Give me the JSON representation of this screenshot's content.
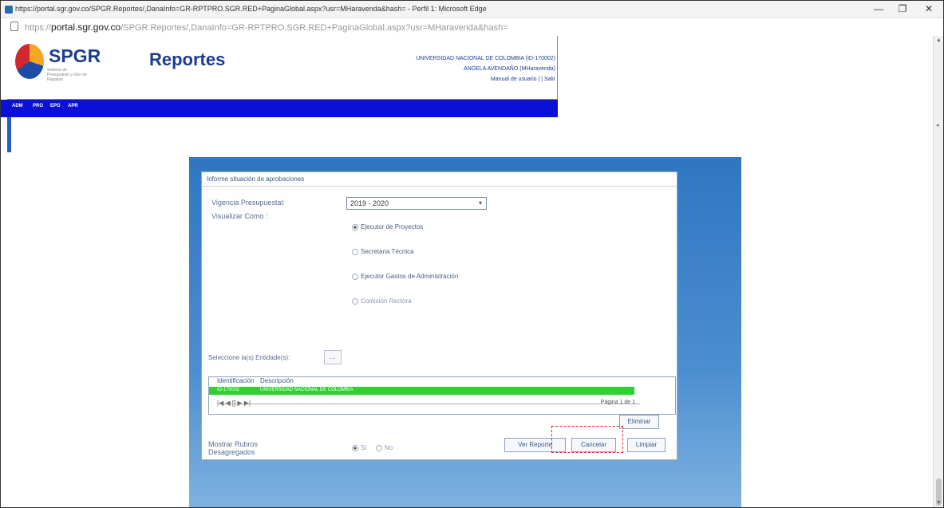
{
  "browser": {
    "window_title": "https://portal.sgr.gov.co/SPGR.Reportes/,DanaInfo=GR-RPTPRO.SGR.RED+PaginaGlobal.aspx?usr=MHaravenda&hash= - Perfil 1: Microsoft Edge",
    "url_prefix": "https://",
    "url_domain": "portal.sgr.gov.co",
    "url_path": "/SPGR.Reportes/,DanaInfo=GR-RPTPRO.SGR.RED+PaginaGlobal.aspx?usr=MHaravenda&hash=",
    "minimize": "—",
    "maximize": "❐",
    "close": "✕"
  },
  "header": {
    "logo_text": "SPGR",
    "logo_sub": "Sistema de Presupuesto y Giro de Regalías",
    "title": "Reportes",
    "org": "UNIVERSIDAD NACIONAL DE COLOMBIA (ID-170002)",
    "user": "ANGELA AVENDAÑO (MHaravenda)",
    "links": "Manual de usuario | | Salir"
  },
  "nav": {
    "items": [
      "ADM",
      "PRO",
      "EPG",
      "APR"
    ]
  },
  "form": {
    "title": "Informe situación de aprobaciones",
    "vigencia_label": "Vigencia Presupuestal:",
    "vigencia_value": "2019 - 2020",
    "visualizar_label": "Visualizar Como :",
    "radios": [
      {
        "label": "Ejecutor de Proyectos",
        "checked": true,
        "disabled": false
      },
      {
        "label": "Secretaria Técnica",
        "checked": false,
        "disabled": false
      },
      {
        "label": "Ejecutor Gastos de Administración",
        "checked": false,
        "disabled": false
      },
      {
        "label": "Comisión Rectora",
        "checked": false,
        "disabled": true
      }
    ],
    "entidades_label": "Seleccione la(s) Entidade(s):",
    "entidades_button": "...",
    "grid": {
      "col_id": "Identificación",
      "col_desc": "Descripción",
      "row_id": "ID-170002",
      "row_desc": "UNIVERSIDAD NACIONAL DE COLOMBIA",
      "pager": "|◀ ◀ [] ▶ ▶|",
      "page_info": "Página 1 de 1"
    },
    "eliminar": "Eliminar",
    "rubros_label_1": "Mostrar Rubros",
    "rubros_label_2": "Desagregados",
    "rubros_si": "Si",
    "rubros_no": "No",
    "btn_ver": "Ver Reporte",
    "btn_cancelar": "Cancelar",
    "btn_limpiar": "Limpiar"
  },
  "colors": {
    "nav_blue": "#0a10d8",
    "brand_blue": "#1a3d8f",
    "grid_selected": "#2ed12e",
    "panel_blue": "#2f76c2"
  }
}
